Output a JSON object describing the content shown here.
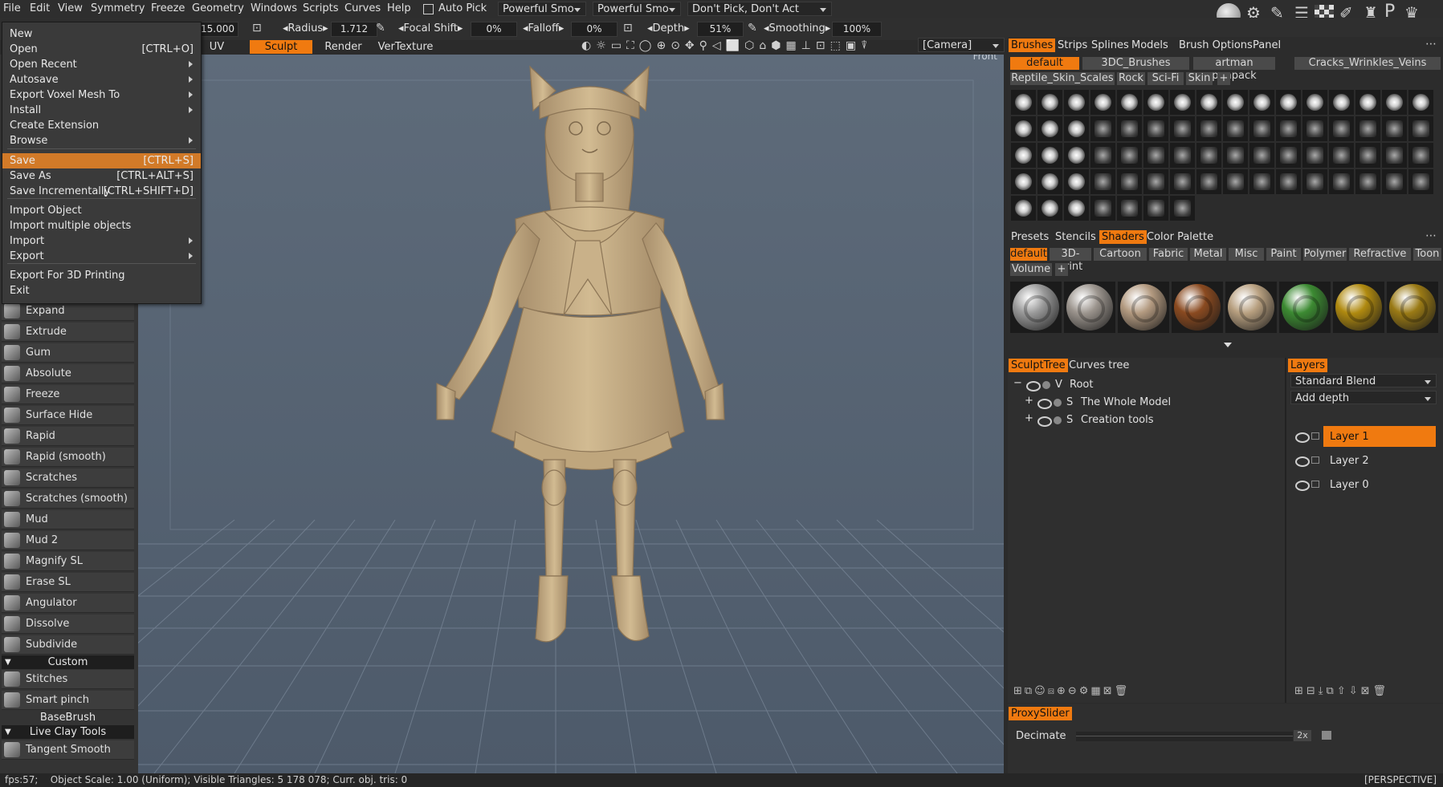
{
  "menubar": [
    "File",
    "Edit",
    "View",
    "Symmetry",
    "Freeze",
    "Geometry",
    "Windows",
    "Scripts",
    "Curves",
    "Help"
  ],
  "toolbar": {
    "auto_pick": "Auto Pick",
    "preset1": "Powerful Smo",
    "preset2": "Powerful Smo",
    "pick_mode": "Don't Pick, Don't Act",
    "size_value": "15.000",
    "radius_label": "Radius",
    "radius_value": "1.712",
    "focal_label": "Focal Shift",
    "focal_value": "0%",
    "falloff_label": "Falloff",
    "falloff_value": "0%",
    "depth_label": "Depth",
    "depth_value": "51%",
    "smoothing_label": "Smoothing",
    "smoothing_value": "100%",
    "camera": "[Camera]"
  },
  "rooms": {
    "uv": "UV",
    "sculpt": "Sculpt",
    "render": "Render",
    "vertexture": "VerTexture"
  },
  "viewport": {
    "view_label": "Front",
    "projection": "[PERSPECTIVE]"
  },
  "file_menu": [
    {
      "label": "New",
      "shortcut": "",
      "arrow": false
    },
    {
      "label": "Open",
      "shortcut": "[CTRL+O]",
      "arrow": false
    },
    {
      "label": "Open Recent",
      "shortcut": "",
      "arrow": true
    },
    {
      "label": "Autosave",
      "shortcut": "",
      "arrow": true
    },
    {
      "label": "Export Voxel Mesh To",
      "shortcut": "",
      "arrow": true
    },
    {
      "label": "Install",
      "shortcut": "",
      "arrow": true
    },
    {
      "label": "Create Extension",
      "shortcut": "",
      "arrow": false
    },
    {
      "label": "Browse",
      "shortcut": "",
      "arrow": true
    },
    {
      "label": "Save",
      "shortcut": "[CTRL+S]",
      "arrow": false
    },
    {
      "label": "Save As",
      "shortcut": "[CTRL+ALT+S]",
      "arrow": false
    },
    {
      "label": "Save Incrementally",
      "shortcut": "[CTRL+SHIFT+D]",
      "arrow": false
    },
    {
      "label": "Import Object",
      "shortcut": "",
      "arrow": false
    },
    {
      "label": "Import multiple objects",
      "shortcut": "",
      "arrow": false
    },
    {
      "label": "Import",
      "shortcut": "",
      "arrow": true
    },
    {
      "label": "Export",
      "shortcut": "",
      "arrow": true
    },
    {
      "label": "Export For 3D Printing",
      "shortcut": "",
      "arrow": false
    },
    {
      "label": "Exit",
      "shortcut": "",
      "arrow": false
    }
  ],
  "tools": [
    "Expand",
    "Extrude",
    "Gum",
    "Absolute",
    "Freeze",
    "Surface Hide",
    "Rapid",
    "Rapid (smooth)",
    "Scratches",
    "Scratches (smooth)",
    "Mud",
    "Mud 2",
    "Magnify SL",
    "Erase SL",
    "Angulator",
    "Dissolve",
    "Subdivide"
  ],
  "tool_sections": {
    "custom": "Custom",
    "basebrush": "BaseBrush",
    "liveclay": "Live Clay Tools"
  },
  "custom_tools": [
    "Stitches",
    "Smart pinch"
  ],
  "liveclay_tools": [
    "Tangent Smooth"
  ],
  "brushes_panel": {
    "tabs": [
      "Brushes",
      "Strips",
      "Splines",
      "Models",
      "Brush Options",
      "Panel"
    ],
    "packs_row1": [
      "default",
      "3DC_Brushes",
      "artman penpack",
      "Cracks_Wrinkles_Veins"
    ],
    "packs_row2": [
      "Reptile_Skin_Scales",
      "Rock",
      "Sci-Fi",
      "Skin",
      "+"
    ]
  },
  "shaders_panel": {
    "tabs": [
      "Presets",
      "Stencils",
      "Shaders",
      "Color Palette"
    ],
    "cats_row1": [
      "default",
      "3D-print",
      "Cartoon",
      "Fabric",
      "Metal",
      "Misc",
      "Paint",
      "Polymer",
      "Refractive",
      "Toon"
    ],
    "cats_row2": [
      "Volume",
      "+"
    ],
    "ball_colors": [
      "#9a9a9a",
      "#9c958e",
      "#b39a80",
      "#8a4a20",
      "#b8a080",
      "#3c8a32",
      "#b08a10",
      "#9a7a15"
    ]
  },
  "sculpt_tree": {
    "tabs": [
      "SculptTree",
      "Curves tree"
    ],
    "rows": [
      {
        "prefix": "V",
        "label": "Root"
      },
      {
        "prefix": "S",
        "label": "The Whole Model"
      },
      {
        "prefix": "S",
        "label": "Creation tools"
      }
    ]
  },
  "layers_panel": {
    "tab": "Layers",
    "blend": "Standard Blend",
    "depth_mode": "Add depth",
    "layers": [
      "Layer 1",
      "Layer 2",
      "Layer 0"
    ]
  },
  "proxy": {
    "tab": "ProxySlider",
    "label": "Decimate",
    "value": "2x"
  },
  "status": "fps:57;    Object Scale: 1.00 (Uniform); Visible Triangles: 5 178 078; Curr. obj. tris: 0",
  "colors": {
    "accent": "#f07a10",
    "menu_highlight": "#d27a28",
    "viewport_bg": "#5c6a7b",
    "model": "#cbb48c"
  }
}
